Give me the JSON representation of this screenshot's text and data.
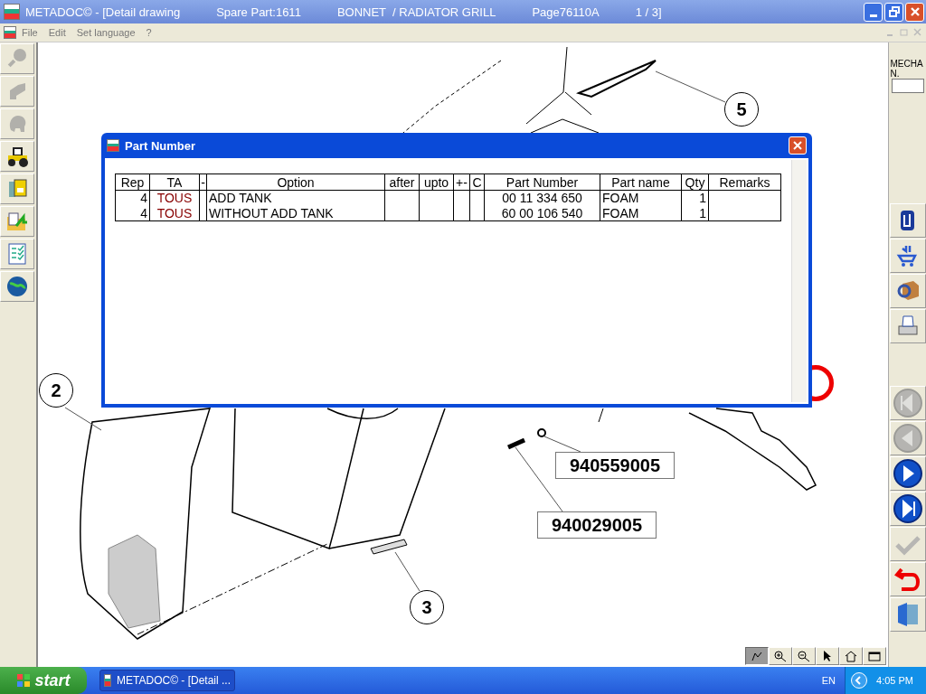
{
  "window": {
    "title_parts": [
      "METADOC© - [Detail drawing",
      "Spare Part:1611",
      "BONNET  / RADIATOR GRILL",
      "Page76110A",
      "1 / 3]"
    ]
  },
  "menu": [
    "File",
    "Edit",
    "Set language",
    "?"
  ],
  "left_toolbar": [
    {
      "kind": "magnifier",
      "disabled": true
    },
    {
      "kind": "boot",
      "disabled": true
    },
    {
      "kind": "blob",
      "disabled": true
    },
    {
      "kind": "tractor",
      "disabled": false
    },
    {
      "kind": "book",
      "disabled": false
    },
    {
      "kind": "folder",
      "disabled": false
    },
    {
      "kind": "checklist",
      "disabled": false
    },
    {
      "kind": "globe",
      "disabled": false
    }
  ],
  "right_panel": {
    "label": "MECHA N."
  },
  "right_tools": [
    {
      "kind": "clip",
      "disabled": false
    },
    {
      "kind": "cart",
      "disabled": false
    },
    {
      "kind": "box",
      "disabled": false
    },
    {
      "kind": "printer",
      "disabled": false
    }
  ],
  "nav_buttons": [
    {
      "kind": "first",
      "disabled": true
    },
    {
      "kind": "prev",
      "disabled": true
    },
    {
      "kind": "next",
      "disabled": false
    },
    {
      "kind": "last",
      "disabled": false
    }
  ],
  "action_buttons": [
    {
      "kind": "check",
      "disabled": true
    },
    {
      "kind": "undo",
      "disabled": false
    },
    {
      "kind": "exit",
      "disabled": false
    }
  ],
  "drawing": {
    "callouts": [
      "5",
      "2",
      "3"
    ],
    "part_labels": [
      "940559005",
      "940029005"
    ]
  },
  "zoom_tools": [
    {
      "kind": "pan",
      "selected": true
    },
    {
      "kind": "zoom-in",
      "selected": false
    },
    {
      "kind": "zoom-out",
      "selected": false
    },
    {
      "kind": "pointer",
      "selected": false
    },
    {
      "kind": "home",
      "selected": false
    },
    {
      "kind": "window",
      "selected": false
    }
  ],
  "dialog": {
    "title": "Part Number",
    "columns": [
      "Rep",
      "TA",
      "-",
      "Option",
      "after",
      "upto",
      "+-",
      "C",
      "Part Number",
      "Part name",
      "Qty",
      "Remarks"
    ],
    "rows": [
      [
        "4",
        "TOUS",
        "",
        "ADD TANK",
        "",
        "",
        "",
        "",
        "00 11 334 650",
        "FOAM",
        "1",
        ""
      ],
      [
        "4",
        "TOUS",
        "",
        "WITHOUT ADD TANK",
        "",
        "",
        "",
        "",
        "60 00 106 540",
        "FOAM",
        "1",
        ""
      ]
    ]
  },
  "taskbar": {
    "start": "start",
    "task": "METADOC© - [Detail ...",
    "language": "EN",
    "clock": "4:05 PM"
  }
}
